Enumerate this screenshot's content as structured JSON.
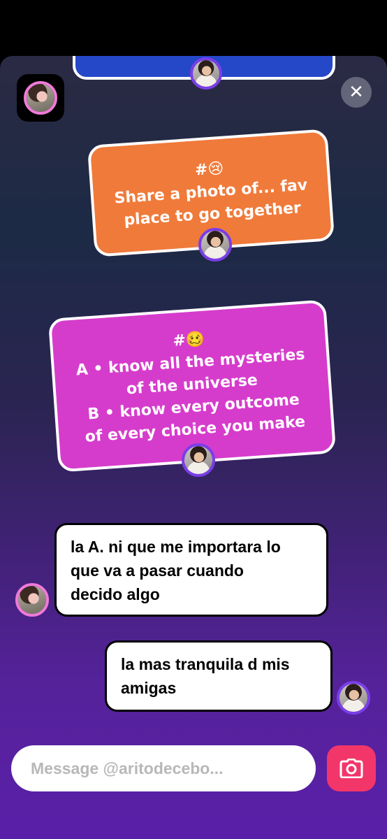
{
  "chat": {
    "prompt_orange": {
      "tag": "#😢",
      "lines": [
        "Share a photo of... fav",
        "place to go together"
      ]
    },
    "prompt_magenta": {
      "tag": "#🥴",
      "lines": [
        "A • know all the mysteries",
        "of the universe",
        "B • know every outcome",
        "of every choice you make"
      ]
    },
    "messages": [
      {
        "side": "left",
        "lines": [
          "la A. ni que me importara lo",
          "que va a pasar cuando",
          "decido algo"
        ]
      },
      {
        "side": "right",
        "lines": [
          "la mas tranquila d mis",
          "amigas"
        ]
      }
    ]
  },
  "composer": {
    "placeholder": "Message @aritodecebo..."
  },
  "icons": {
    "close": "close-icon",
    "camera": "camera-icon"
  },
  "colors": {
    "orange_card": "#f07a3a",
    "magenta_card": "#d63ccc",
    "camera_button": "#f2366a",
    "top_card": "#2548c9"
  }
}
